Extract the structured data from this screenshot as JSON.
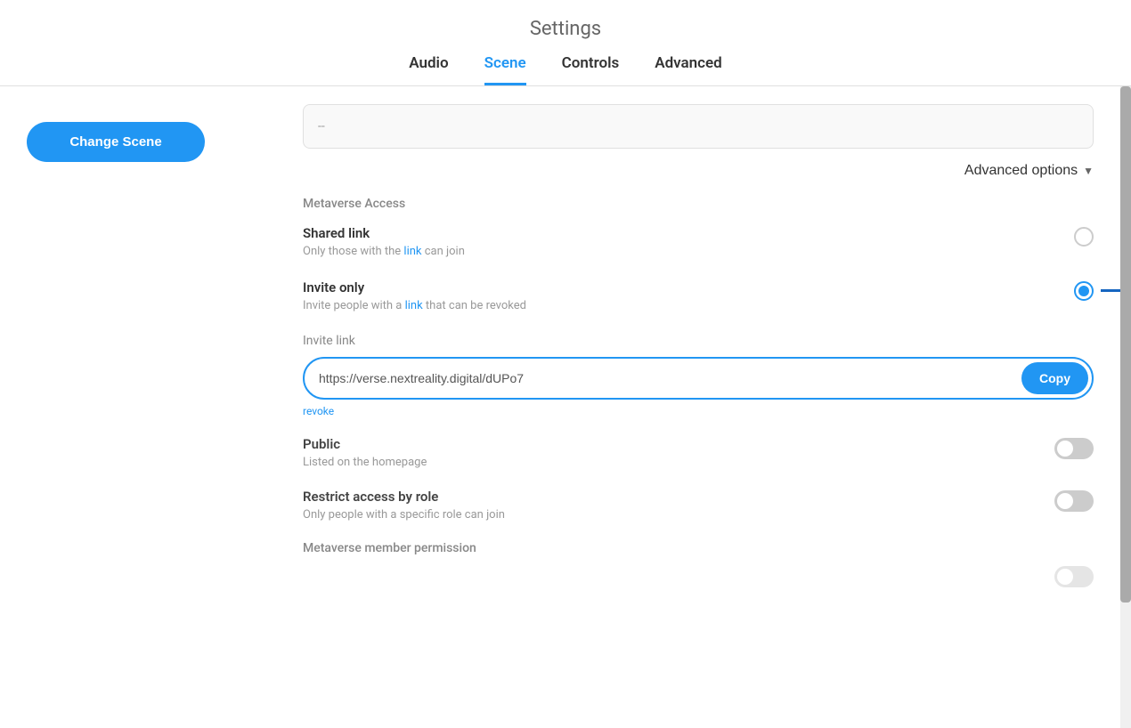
{
  "header": {
    "title": "Settings"
  },
  "tabs": [
    {
      "id": "audio",
      "label": "Audio",
      "active": false
    },
    {
      "id": "scene",
      "label": "Scene",
      "active": true
    },
    {
      "id": "controls",
      "label": "Controls",
      "active": false
    },
    {
      "id": "advanced",
      "label": "Advanced",
      "active": false
    }
  ],
  "sidebar": {
    "change_scene_button": "Change Scene"
  },
  "advanced_options": {
    "label": "Advanced options",
    "dropdown_arrow": "▼"
  },
  "metaverse_access": {
    "section_title": "Metaverse Access",
    "options": [
      {
        "id": "shared-link",
        "label": "Shared link",
        "description_plain": "Only those with the ",
        "description_link": "link",
        "description_end": " can join",
        "selected": false
      },
      {
        "id": "invite-only",
        "label": "Invite only",
        "description_plain": "Invite people with a ",
        "description_link": "link",
        "description_end": " that can be revoked",
        "selected": true
      }
    ]
  },
  "invite_link": {
    "label": "Invite link",
    "url": "https://verse.nextreality.digital/dUPo7",
    "copy_button": "Copy",
    "revoke_label": "revoke"
  },
  "public_section": {
    "label": "Public",
    "description": "Listed on the homepage",
    "enabled": false
  },
  "restrict_access": {
    "label": "Restrict access by role",
    "description": "Only people with a specific role can join",
    "enabled": false
  },
  "member_permission": {
    "section_title": "Metaverse member permission"
  },
  "top_input_placeholder": "--"
}
